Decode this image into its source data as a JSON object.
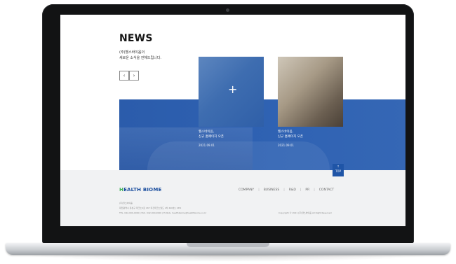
{
  "news": {
    "title": "NEWS",
    "subtitle_line1": "(주)헬스바이옴의",
    "subtitle_line2": "새로운 소식을 전해드립니다.",
    "prev_label": "‹",
    "next_label": "›"
  },
  "cards": [
    {
      "title_line1": "헬스바이옴,",
      "title_line2": "신규 홈페이지 오픈",
      "date": "2021.09.01"
    },
    {
      "title_line1": "헬스바이옴,",
      "title_line2": "신규 홈페이지 오픈",
      "date": "2021.09.01"
    }
  ],
  "top_button": {
    "label": "TOP"
  },
  "footer": {
    "logo_prefix": "H",
    "logo_rest": "EALTH BIOME",
    "nav": [
      "COMPANY",
      "BUSINESS",
      "R&D",
      "PR",
      "CONTACT"
    ],
    "line1": "(주)헬스바이옴",
    "line2": "대전광역시 유성구 테크노2로 187 미건테크노월드 2차 406호 | CEO",
    "line3": "TEL. 042-000-0000  |  FAX. 042-000-0000  |  E-MAIL. healthbiome@healthbiome.co.kr",
    "copyright": "Copyright © 2021 (주)헬스바이옴 All Right Reserved"
  },
  "colors": {
    "brand_blue": "#1f55a7",
    "brand_green": "#43b35a",
    "bezel": "#121314"
  }
}
